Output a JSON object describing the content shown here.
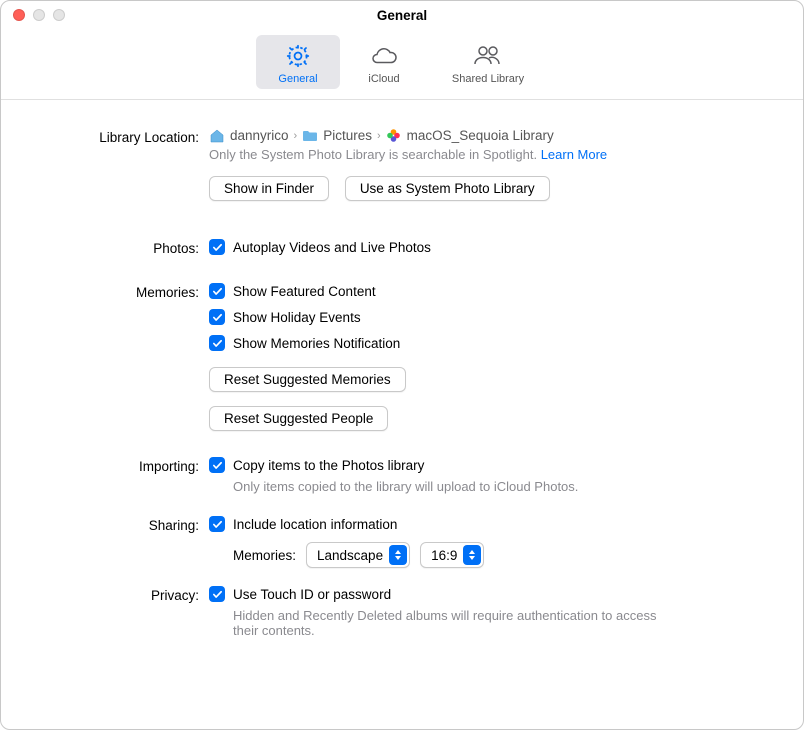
{
  "window": {
    "title": "General"
  },
  "toolbar": {
    "items": [
      {
        "label": "General"
      },
      {
        "label": "iCloud"
      },
      {
        "label": "Shared Library"
      }
    ]
  },
  "library": {
    "label": "Library Location:",
    "breadcrumb": [
      {
        "icon": "home",
        "label": "dannyrico"
      },
      {
        "icon": "folder",
        "label": "Pictures"
      },
      {
        "icon": "photos-app",
        "label": "macOS_Sequoia Library"
      }
    ],
    "hint": "Only the System Photo Library is searchable in Spotlight.",
    "learn_more": "Learn More",
    "buttons": {
      "show_in_finder": "Show in Finder",
      "use_system": "Use as System Photo Library"
    }
  },
  "photos": {
    "label": "Photos:",
    "autoplay": "Autoplay Videos and Live Photos"
  },
  "memories": {
    "label": "Memories:",
    "featured": "Show Featured Content",
    "holiday": "Show Holiday Events",
    "notification": "Show Memories Notification",
    "reset_memories": "Reset Suggested Memories",
    "reset_people": "Reset Suggested People"
  },
  "importing": {
    "label": "Importing:",
    "copy": "Copy items to the Photos library",
    "hint": "Only items copied to the library will upload to iCloud Photos."
  },
  "sharing": {
    "label": "Sharing:",
    "location": "Include location information",
    "memories_label": "Memories:",
    "orientation": "Landscape",
    "aspect": "16:9"
  },
  "privacy": {
    "label": "Privacy:",
    "touchid": "Use Touch ID or password",
    "hint": "Hidden and Recently Deleted albums will require authentication to access their contents."
  }
}
